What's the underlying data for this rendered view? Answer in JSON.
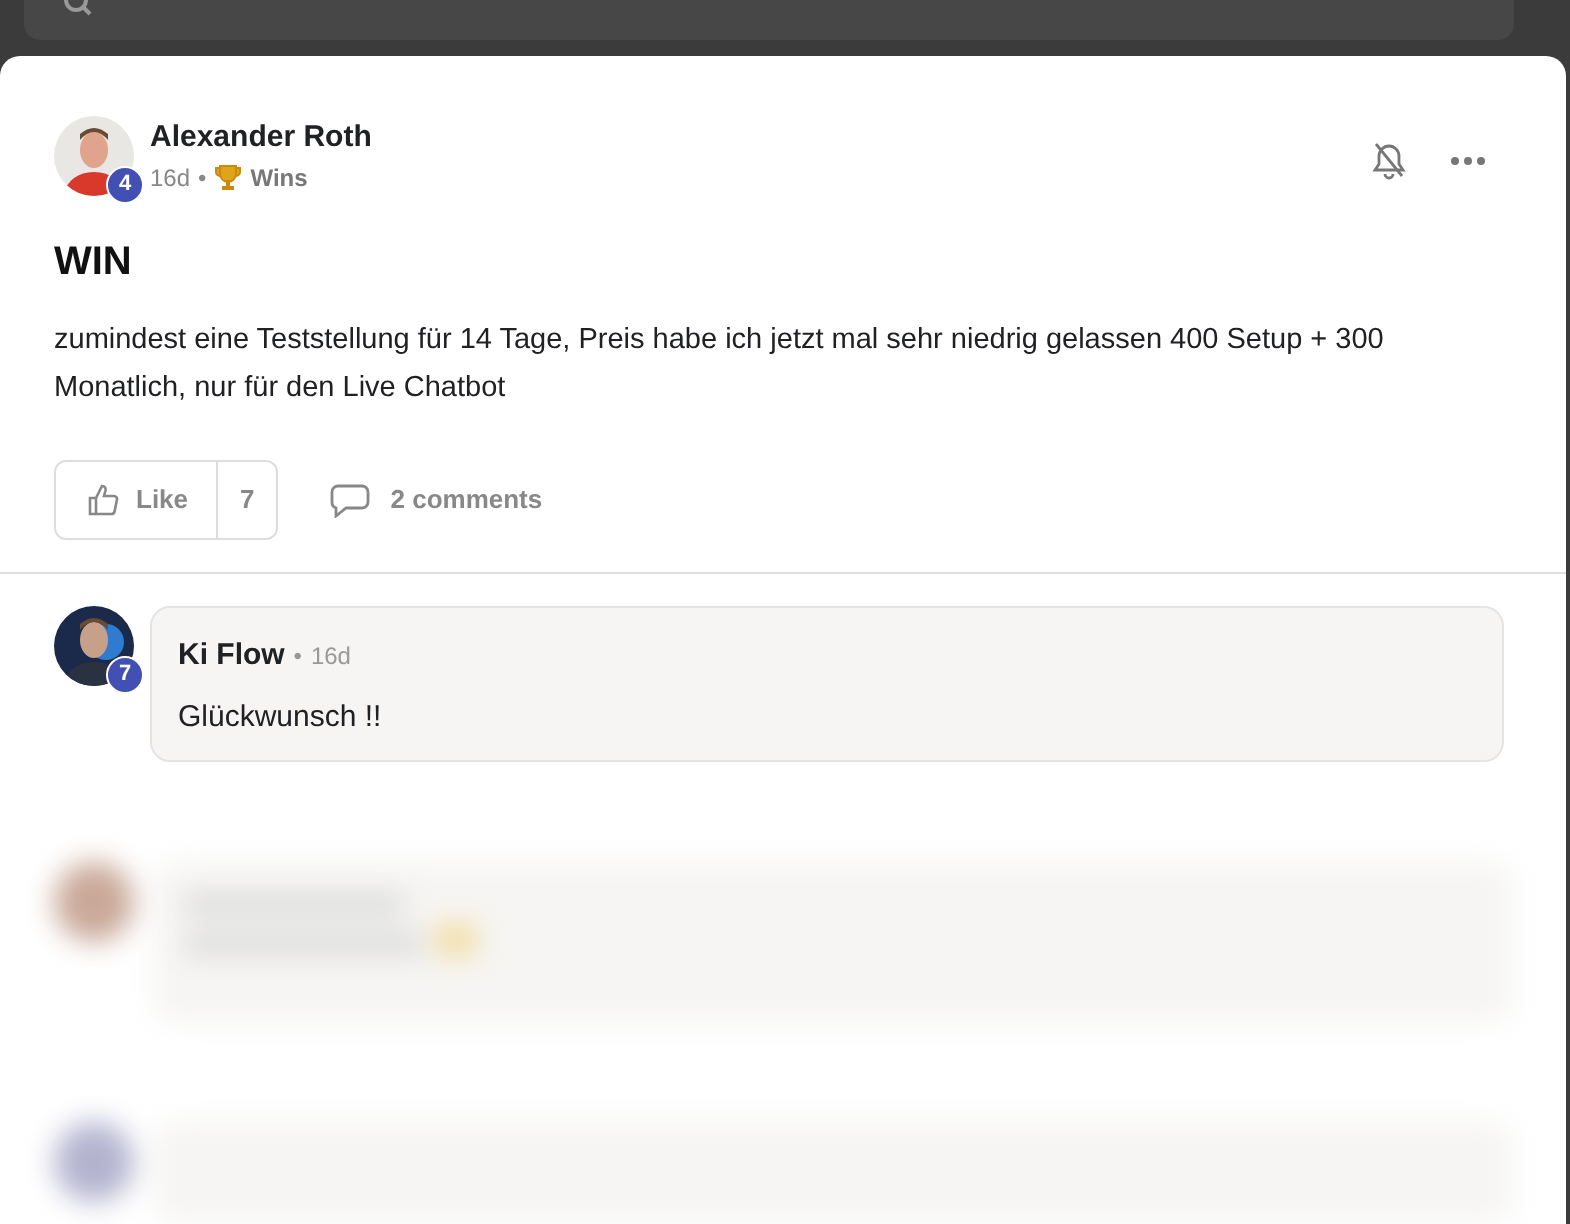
{
  "post": {
    "author": "Alexander Roth",
    "level_badge": "4",
    "time": "16d",
    "separator": "•",
    "category": "Wins",
    "title": "WIN",
    "body": "zumindest eine Teststellung für 14 Tage, Preis habe ich jetzt mal sehr niedrig gelassen 400 Setup + 300 Monatlich, nur für den Live Chatbot",
    "like_label": "Like",
    "like_count": "7",
    "liked": false,
    "comments_label": "2 comments"
  },
  "comments": [
    {
      "author": "Ki Flow",
      "level_badge": "7",
      "separator": "•",
      "time": "16d",
      "text": "Glückwunsch !!"
    }
  ]
}
